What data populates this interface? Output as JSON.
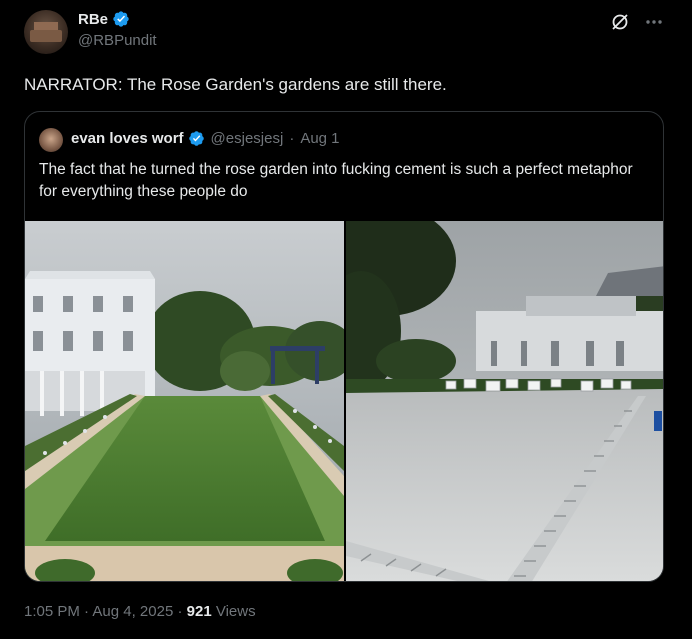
{
  "author": {
    "name": "RBe",
    "handle": "@RBPundit"
  },
  "tweet": {
    "text": "NARRATOR: The Rose Garden's gardens are still there."
  },
  "quoted": {
    "name": "evan loves worf",
    "handle": "@esjesjesj",
    "separator": "·",
    "date": "Aug 1",
    "text": "The fact that he turned the rose garden into fucking cement is such a perfect metaphor for everything these people do"
  },
  "footer": {
    "time": "1:05 PM",
    "sep1": "·",
    "date": "Aug 4, 2025",
    "sep2": "·",
    "views_count": "921",
    "views_label": "Views"
  },
  "icons": {
    "verified": "verified-badge-icon",
    "grok": "grok-icon",
    "more": "more-icon"
  },
  "colors": {
    "verified": "#1d9bf0",
    "text_primary": "#e7e9ea",
    "text_secondary": "#71767b",
    "border": "#2f3336"
  }
}
